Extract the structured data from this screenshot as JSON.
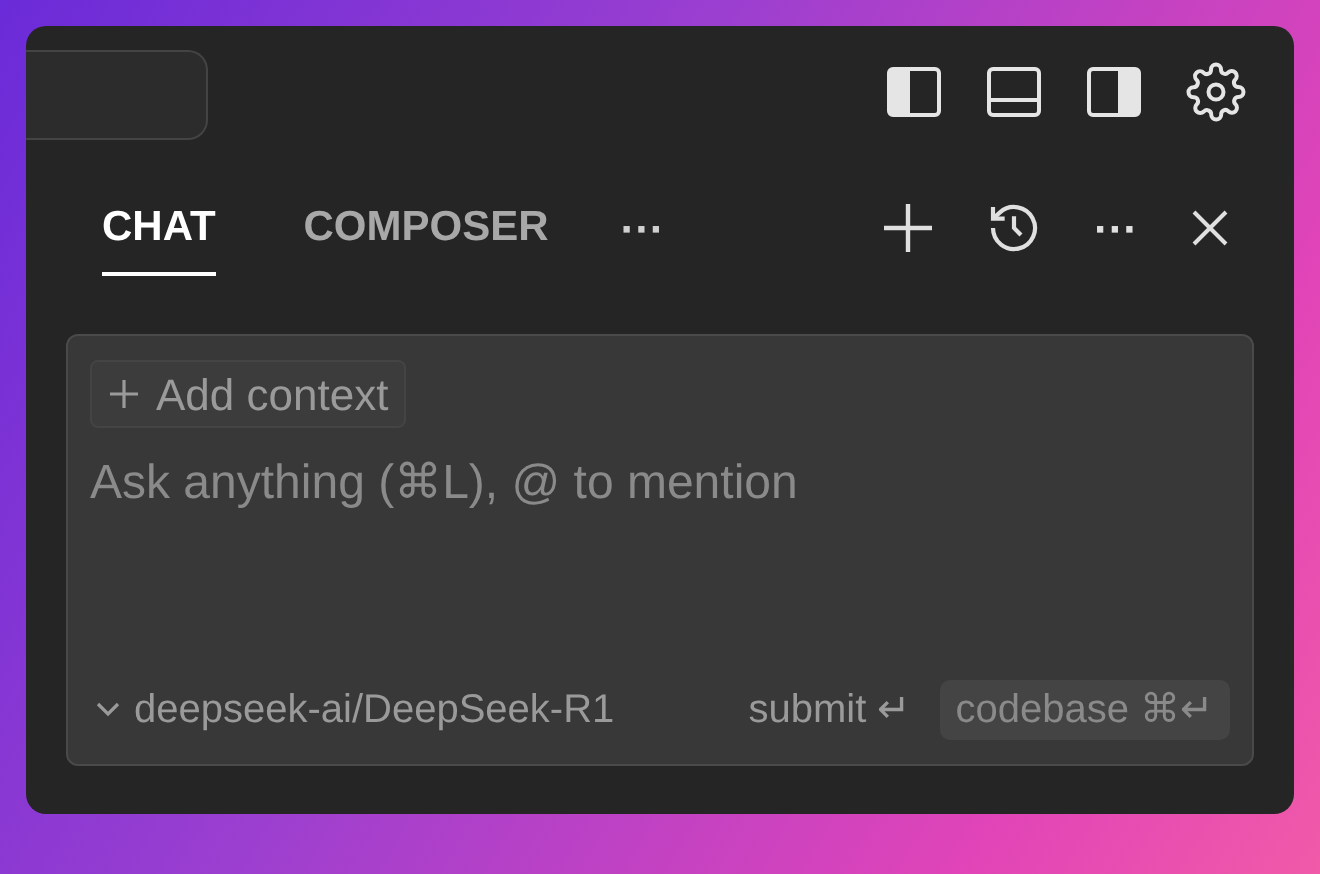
{
  "tabs": [
    {
      "label": "CHAT",
      "selected": true
    },
    {
      "label": "COMPOSER",
      "selected": false
    }
  ],
  "tabs_more": "···",
  "toolbar_more": "···",
  "input": {
    "add_context": "Add context",
    "placeholder": "Ask anything (⌘L), @ to mention"
  },
  "model": "deepseek-ai/DeepSeek-R1",
  "submit": {
    "label": "submit",
    "key": "↵"
  },
  "codebase": {
    "label": "codebase",
    "key": "⌘↵"
  }
}
